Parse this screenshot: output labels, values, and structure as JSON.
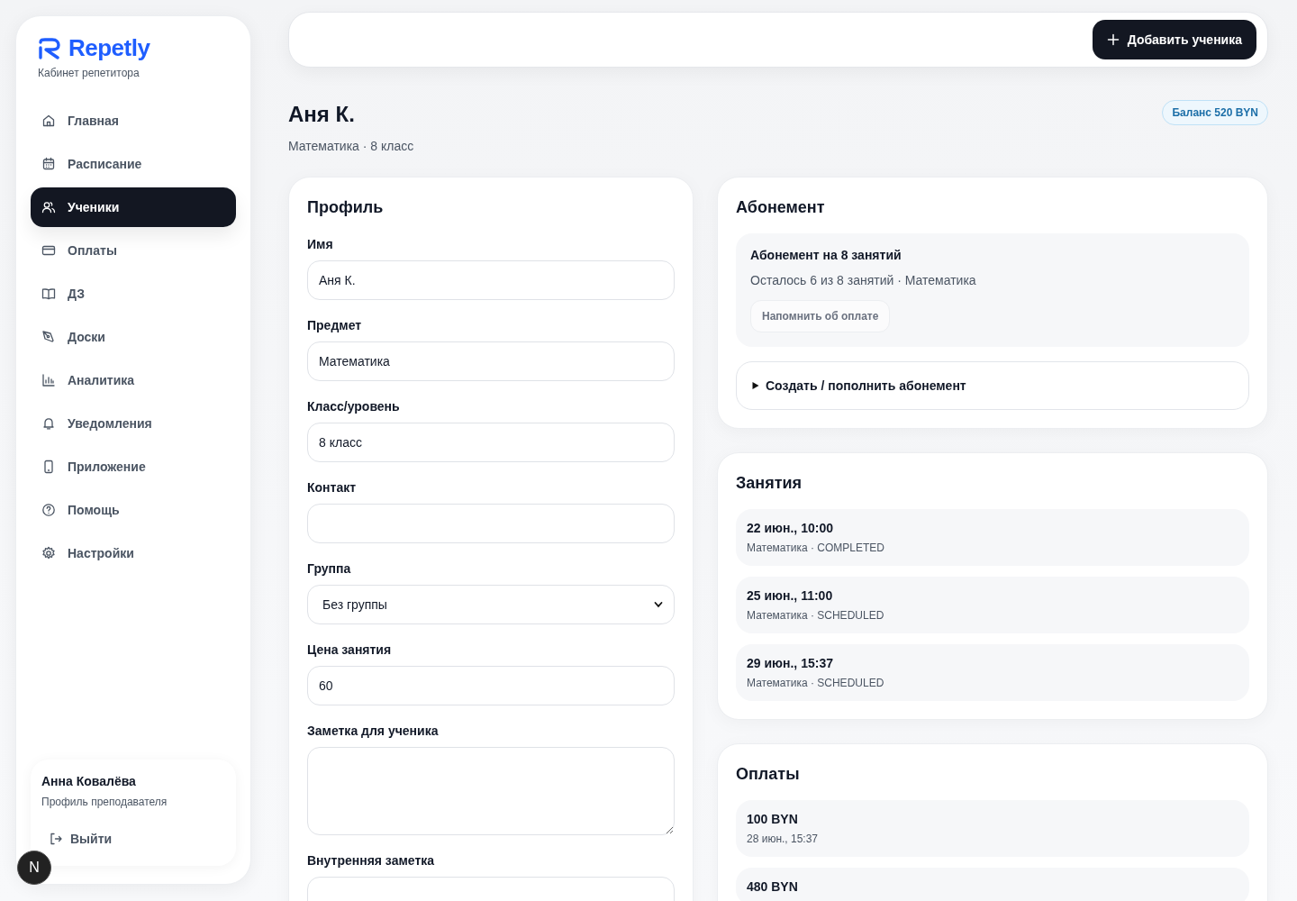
{
  "sidebar": {
    "logo": "Repetly",
    "subtitle": "Кабинет репетитора",
    "items": [
      {
        "label": "Главная",
        "selected": false
      },
      {
        "label": "Расписание",
        "selected": false
      },
      {
        "label": "Ученики",
        "selected": true
      },
      {
        "label": "Оплаты",
        "selected": false
      },
      {
        "label": "ДЗ",
        "selected": false
      },
      {
        "label": "Доски",
        "selected": false
      },
      {
        "label": "Аналитика",
        "selected": false
      },
      {
        "label": "Уведомления",
        "selected": false
      },
      {
        "label": "Приложение",
        "selected": false
      },
      {
        "label": "Помощь",
        "selected": false
      },
      {
        "label": "Настройки",
        "selected": false
      }
    ],
    "user": {
      "name": "Анна Ковалёва",
      "role": "Профиль преподавателя",
      "logout": "Выйти"
    }
  },
  "dev_badge": "N",
  "topbar": {
    "add_button": "Добавить ученика"
  },
  "header": {
    "title": "Аня К.",
    "subtitle": "Математика · 8 класс",
    "balance": "Баланс 520 BYN"
  },
  "profile": {
    "title": "Профиль",
    "fields": [
      {
        "label": "Имя",
        "kind": "text",
        "value": "Аня К."
      },
      {
        "label": "Предмет",
        "kind": "text",
        "value": "Математика"
      },
      {
        "label": "Класс/уровень",
        "kind": "text",
        "value": "8 класс"
      },
      {
        "label": "Контакт",
        "kind": "text"
      },
      {
        "label": "Группа",
        "kind": "select",
        "value": "Без группы"
      },
      {
        "label": "Цена занятия",
        "kind": "text",
        "value": "60"
      },
      {
        "label": "Заметка для ученика",
        "kind": "textarea"
      },
      {
        "label": "Внутренняя заметка",
        "kind": "textarea"
      }
    ]
  },
  "subscription": {
    "title": "Абонемент",
    "plan": "Абонемент на 8 занятий",
    "remaining": "Осталось 6 из 8 занятий · Математика",
    "remind_button": "Напомнить об оплате",
    "create": {
      "label": "Создать / пополнить абонемент",
      "expanded": false
    }
  },
  "lessons": {
    "title": "Занятия",
    "items": [
      {
        "date": "22 июн., 10:00",
        "info": "Математика · COMPLETED"
      },
      {
        "date": "25 июн., 11:00",
        "info": "Математика · SCHEDULED"
      },
      {
        "date": "29 июн., 15:37",
        "info": "Математика · SCHEDULED"
      }
    ]
  },
  "payments": {
    "title": "Оплаты",
    "items": [
      {
        "amount": "100 BYN",
        "date": "28 июн., 15:37"
      },
      {
        "amount": "480 BYN"
      }
    ]
  }
}
